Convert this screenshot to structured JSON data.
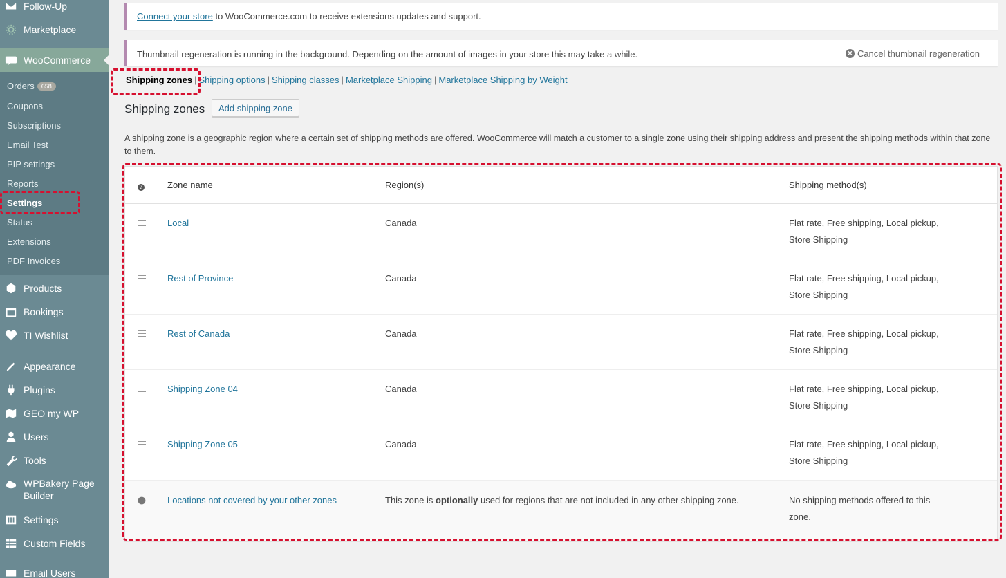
{
  "sidebar": {
    "top_items": [
      {
        "label": "Follow-Up",
        "icon": "envelope-icon"
      },
      {
        "label": "Marketplace",
        "icon": "gear-icon"
      }
    ],
    "woocommerce": {
      "label": "WooCommerce",
      "icon": "woo-icon"
    },
    "submenu": [
      {
        "label": "Orders",
        "badge": "658"
      },
      {
        "label": "Coupons"
      },
      {
        "label": "Subscriptions"
      },
      {
        "label": "Email Test"
      },
      {
        "label": "PIP settings"
      },
      {
        "label": "Reports"
      },
      {
        "label": "Settings"
      },
      {
        "label": "Status"
      },
      {
        "label": "Extensions"
      },
      {
        "label": "PDF Invoices"
      }
    ],
    "bottom_items": [
      {
        "label": "Products"
      },
      {
        "label": "Bookings"
      },
      {
        "label": "TI Wishlist"
      },
      {
        "label": "Appearance"
      },
      {
        "label": "Plugins"
      },
      {
        "label": "GEO my WP"
      },
      {
        "label": "Users"
      },
      {
        "label": "Tools"
      },
      {
        "label": "WPBakery Page"
      },
      {
        "label": "Settings"
      },
      {
        "label": "Custom Fields"
      },
      {
        "label": "Email Users"
      }
    ],
    "wpbakery_line2": "Builder",
    "current_submenu": "Settings"
  },
  "notices": {
    "connect": {
      "link": "Connect your store",
      "text": " to WooCommerce.com to receive extensions updates and support."
    },
    "thumbnail": {
      "text": "Thumbnail regeneration is running in the background. Depending on the amount of images in your store this may take a while.",
      "cancel": "Cancel thumbnail regeneration"
    }
  },
  "subnav": [
    {
      "label": "Shipping zones",
      "current": true
    },
    {
      "label": "Shipping options"
    },
    {
      "label": "Shipping classes"
    },
    {
      "label": "Marketplace Shipping"
    },
    {
      "label": "Marketplace Shipping by Weight"
    }
  ],
  "page": {
    "title": "Shipping zones",
    "add_button": "Add shipping zone",
    "description": "A shipping zone is a geographic region where a certain set of shipping methods are offered. WooCommerce will match a customer to a single zone using their shipping address and present the shipping methods within that zone to them."
  },
  "table": {
    "headers": {
      "name": "Zone name",
      "region": "Region(s)",
      "methods": "Shipping method(s)"
    },
    "zones": [
      {
        "name": "Local",
        "region": "Canada",
        "methods_line1": "Flat rate, Free shipping, Local pickup,",
        "methods_line2": "Store Shipping"
      },
      {
        "name": "Rest of Province",
        "region": "Canada",
        "methods_line1": "Flat rate, Free shipping, Local pickup,",
        "methods_line2": "Store Shipping"
      },
      {
        "name": "Rest of Canada",
        "region": "Canada",
        "methods_line1": "Flat rate, Free shipping, Local pickup,",
        "methods_line2": "Store Shipping"
      },
      {
        "name": "Shipping Zone 04",
        "region": "Canada",
        "methods_line1": "Flat rate, Free shipping, Local pickup,",
        "methods_line2": "Store Shipping"
      },
      {
        "name": "Shipping Zone 05",
        "region": "Canada",
        "methods_line1": "Flat rate, Free shipping, Local pickup,",
        "methods_line2": "Store Shipping"
      }
    ],
    "rest_of_world": {
      "name": "Locations not covered by your other zones",
      "region_before": "This zone is ",
      "region_bold": "optionally",
      "region_after": " used for regions that are not included in any other shipping zone.",
      "methods_line1": "No shipping methods offered to this",
      "methods_line2": "zone."
    }
  },
  "colors": {
    "highlight": "#d6102f",
    "link": "#21759b",
    "sidebar": "#6b8a93"
  }
}
